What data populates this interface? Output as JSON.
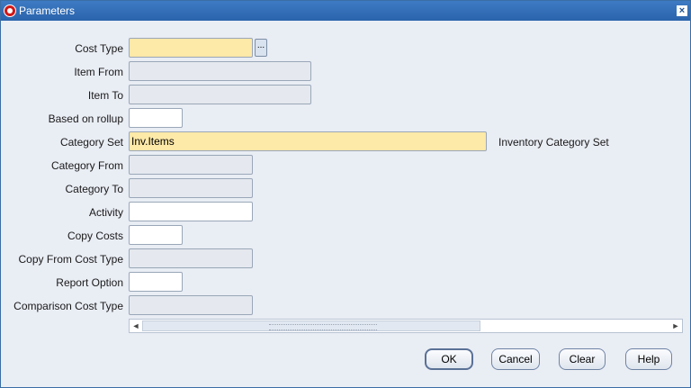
{
  "window": {
    "title": "Parameters",
    "close_glyph": "×"
  },
  "form": {
    "cost_type": {
      "label": "Cost Type",
      "value": "",
      "lov_glyph": "..."
    },
    "item_from": {
      "label": "Item From",
      "value": ""
    },
    "item_to": {
      "label": "Item To",
      "value": ""
    },
    "based_on_rollup": {
      "label": "Based on rollup",
      "value": ""
    },
    "category_set": {
      "label": "Category Set",
      "value": "Inv.Items",
      "description": "Inventory Category Set"
    },
    "category_from": {
      "label": "Category From",
      "value": ""
    },
    "category_to": {
      "label": "Category To",
      "value": ""
    },
    "activity": {
      "label": "Activity",
      "value": ""
    },
    "copy_costs": {
      "label": "Copy Costs",
      "value": ""
    },
    "copy_from_cost_type": {
      "label": "Copy From Cost Type",
      "value": ""
    },
    "report_option": {
      "label": "Report Option",
      "value": ""
    },
    "comparison_cost_type": {
      "label": "Comparison Cost Type",
      "value": ""
    }
  },
  "scrollbar": {
    "left_arrow": "◄",
    "right_arrow": "►"
  },
  "buttons": {
    "ok": "OK",
    "cancel": "Cancel",
    "clear": "Clear",
    "help": "Help"
  },
  "colors": {
    "title_bar": "#2a63ab",
    "required_field": "#fde9a8",
    "disabled_field": "#e5e9ef",
    "background": "#e9edf4"
  }
}
